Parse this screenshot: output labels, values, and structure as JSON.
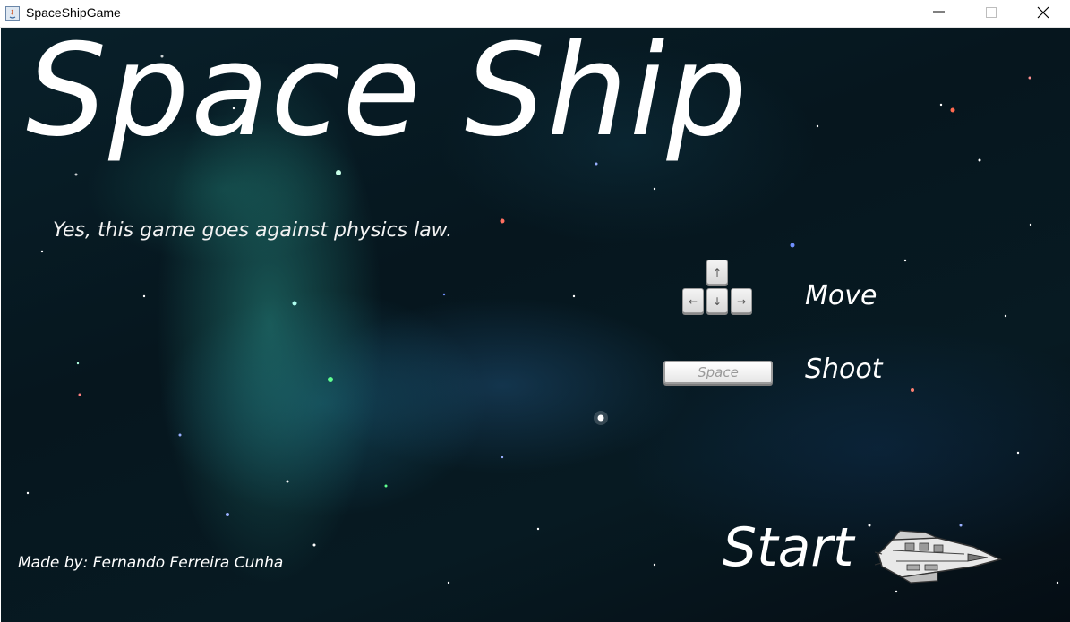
{
  "window": {
    "title": "SpaceShipGame",
    "controls": [
      "minimize-icon",
      "maximize-icon",
      "close-icon"
    ]
  },
  "menu": {
    "game_title": "Space Ship",
    "tagline": "Yes, this game goes against physics law.",
    "controls": {
      "move": {
        "keys": {
          "up": "↑",
          "left": "←",
          "down": "↓",
          "right": "→"
        },
        "label": "Move"
      },
      "shoot": {
        "key": "Space",
        "label": "Shoot"
      }
    },
    "credits": "Made by: Fernando Ferreira Cunha",
    "start_label": "Start",
    "ship_icon": "spaceship-icon"
  },
  "colors": {
    "text": "#ffffff",
    "background": "#06161e",
    "nebula": "#2a8c82"
  }
}
